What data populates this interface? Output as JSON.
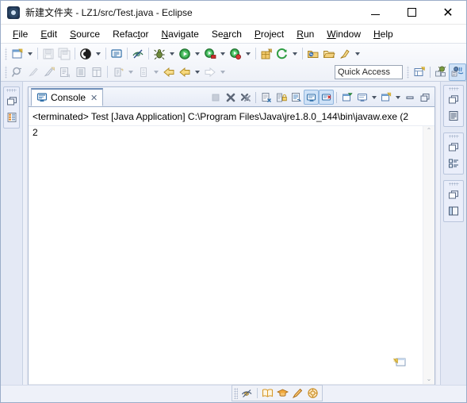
{
  "window": {
    "title": "新建文件夹 - LZ1/src/Test.java - Eclipse",
    "app_icon": "eclipse-icon",
    "controls": {
      "minimize": "minimize-button",
      "maximize": "maximize-button",
      "close_label": "✕"
    }
  },
  "menubar": {
    "items": [
      {
        "label": "File",
        "mnemonic": "F"
      },
      {
        "label": "Edit",
        "mnemonic": "E"
      },
      {
        "label": "Source",
        "mnemonic": "S"
      },
      {
        "label": "Refactor",
        "mnemonic": "t"
      },
      {
        "label": "Navigate",
        "mnemonic": "N"
      },
      {
        "label": "Search",
        "mnemonic": "a"
      },
      {
        "label": "Project",
        "mnemonic": "P"
      },
      {
        "label": "Run",
        "mnemonic": "R"
      },
      {
        "label": "Window",
        "mnemonic": "W"
      },
      {
        "label": "Help",
        "mnemonic": "H"
      }
    ]
  },
  "toolbar": {
    "row1": [
      {
        "name": "new-wizard-icon",
        "tooltip": "New"
      },
      {
        "name": "new-dropdown-arrow",
        "tooltip": "New menu"
      },
      {
        "name": "save-icon",
        "tooltip": "Save"
      },
      {
        "name": "save-all-icon",
        "tooltip": "Save All"
      },
      {
        "name": "skip-breakpoints-icon",
        "tooltip": "Skip All Breakpoints"
      },
      {
        "name": "skip-breakpoints-dropdown-arrow",
        "tooltip": ""
      },
      {
        "name": "open-type-icon",
        "tooltip": "Open Type"
      },
      {
        "name": "toggle-mark-occurrences-icon",
        "tooltip": "Toggle Mark Occurrences"
      },
      {
        "name": "debug-icon",
        "tooltip": "Debug"
      },
      {
        "name": "debug-dropdown-arrow",
        "tooltip": ""
      },
      {
        "name": "run-icon",
        "tooltip": "Run"
      },
      {
        "name": "run-dropdown-arrow",
        "tooltip": ""
      },
      {
        "name": "run-external-tools-icon",
        "tooltip": "External Tools"
      },
      {
        "name": "external-tools-dropdown-arrow",
        "tooltip": ""
      },
      {
        "name": "coverage-icon",
        "tooltip": "Coverage"
      },
      {
        "name": "coverage-dropdown-arrow",
        "tooltip": ""
      },
      {
        "name": "new-java-package-icon",
        "tooltip": "New Java Package"
      },
      {
        "name": "refresh-icon",
        "tooltip": "Refresh"
      },
      {
        "name": "refresh-dropdown-arrow",
        "tooltip": ""
      },
      {
        "name": "open-folder-icon",
        "tooltip": "Open"
      },
      {
        "name": "open-task-icon",
        "tooltip": "Open Task"
      },
      {
        "name": "pin-icon",
        "tooltip": "Pin"
      },
      {
        "name": "pin-dropdown-arrow",
        "tooltip": ""
      }
    ],
    "row2": [
      {
        "name": "search-declaration-icon",
        "tooltip": "Search"
      },
      {
        "name": "annotation-icon",
        "tooltip": "Next Annotation"
      },
      {
        "name": "last-edit-location-icon",
        "tooltip": "Last Edit Location"
      },
      {
        "name": "open-declaration-icon",
        "tooltip": "Open Declaration"
      },
      {
        "name": "outline-icon",
        "tooltip": "Outline"
      },
      {
        "name": "table-icon",
        "tooltip": "Table"
      },
      {
        "name": "previous-annotation-icon",
        "tooltip": "Previous Annotation"
      },
      {
        "name": "previous-annotation-dropdown-arrow",
        "tooltip": ""
      },
      {
        "name": "next-annotation-icon",
        "tooltip": "Next Annotation"
      },
      {
        "name": "next-annotation-dropdown-arrow",
        "tooltip": ""
      },
      {
        "name": "back-arrow-icon",
        "tooltip": "Back"
      },
      {
        "name": "back-history-icon",
        "tooltip": "Back History"
      },
      {
        "name": "back-dropdown-arrow",
        "tooltip": ""
      },
      {
        "name": "forward-arrow-icon",
        "tooltip": "Forward"
      },
      {
        "name": "forward-dropdown-arrow",
        "tooltip": ""
      }
    ],
    "quick_access": {
      "label": "Quick Access",
      "placeholder": "Quick Access"
    },
    "perspective": [
      {
        "name": "open-perspective-icon",
        "tooltip": "Open Perspective"
      },
      {
        "name": "perspective-debug-icon",
        "tooltip": "Debug",
        "selected": false
      },
      {
        "name": "perspective-java-icon",
        "tooltip": "Java",
        "selected": true
      }
    ]
  },
  "left_fastview": {
    "groups": [
      {
        "restore": "restore-icon",
        "items": [
          {
            "name": "package-explorer-icon",
            "tooltip": "Package Explorer"
          }
        ]
      }
    ]
  },
  "right_fastview": {
    "groups": [
      {
        "restore": "restore-icon",
        "items": [
          {
            "name": "outline-view-icon",
            "tooltip": "Outline"
          }
        ]
      },
      {
        "restore": "restore-icon",
        "items": [
          {
            "name": "task-list-view-icon",
            "tooltip": "Task List"
          }
        ]
      },
      {
        "restore": "restore-icon",
        "items": [
          {
            "name": "editor-area-icon",
            "tooltip": "Restore Editor Area"
          }
        ]
      }
    ]
  },
  "console_view": {
    "tab": {
      "label": "Console",
      "icon": "console-icon",
      "close_glyph": "✕"
    },
    "toolbar": [
      {
        "name": "terminate-icon",
        "tooltip": "Terminate",
        "enabled": false
      },
      {
        "name": "remove-launch-icon",
        "tooltip": "Remove Launch"
      },
      {
        "name": "remove-all-terminated-icon",
        "tooltip": "Remove All Terminated Launches"
      },
      {
        "name": "clear-console-icon",
        "tooltip": "Clear Console"
      },
      {
        "name": "scroll-lock-icon",
        "tooltip": "Scroll Lock"
      },
      {
        "name": "word-wrap-icon",
        "tooltip": "Word Wrap"
      },
      {
        "name": "show-console-on-output-icon",
        "tooltip": "Show Console When Standard Out Changes",
        "selected": true
      },
      {
        "name": "show-console-on-error-icon",
        "tooltip": "Show Console When Standard Error Changes",
        "selected": true
      },
      {
        "name": "pin-console-icon",
        "tooltip": "Pin Console"
      },
      {
        "name": "display-selected-console-icon",
        "tooltip": "Display Selected Console"
      },
      {
        "name": "display-selected-console-dropdown-arrow",
        "tooltip": ""
      },
      {
        "name": "open-console-icon",
        "tooltip": "Open Console"
      },
      {
        "name": "open-console-dropdown-arrow",
        "tooltip": ""
      },
      {
        "name": "minimize-view-icon",
        "tooltip": "Minimize"
      },
      {
        "name": "maximize-view-icon",
        "tooltip": "Maximize"
      }
    ],
    "process_header": "<terminated> Test [Java Application] C:\\Program Files\\Java\\jre1.8.0_144\\bin\\javaw.exe (2",
    "output": "2",
    "scroll": {
      "up_glyph": "⌃",
      "down_glyph": "⌄",
      "left_glyph": "‹",
      "right_glyph": "›"
    }
  },
  "float_toolbar": {
    "items": [
      {
        "name": "toggle-mark-occurrences-icon",
        "tooltip": "Toggle Mark Occurrences"
      },
      {
        "name": "open-book-icon",
        "tooltip": "Open Book"
      },
      {
        "name": "graduation-cap-icon",
        "tooltip": "Tutorial"
      },
      {
        "name": "pencil-icon",
        "tooltip": "Edit"
      },
      {
        "name": "target-icon",
        "tooltip": "Target"
      }
    ]
  },
  "corner": {
    "hint_icon": "restore-editor-hint-icon"
  },
  "colors": {
    "window_bg": "#eef1f9",
    "titlebar_bg": "#ffffff",
    "toolbar_bg": "#f2f5fb",
    "tab_selected_top": "#6f8fb9",
    "accent_selected": "#cfe2f7",
    "console_bg": "#ffffff",
    "text": "#000000",
    "border": "#aebcd4"
  }
}
